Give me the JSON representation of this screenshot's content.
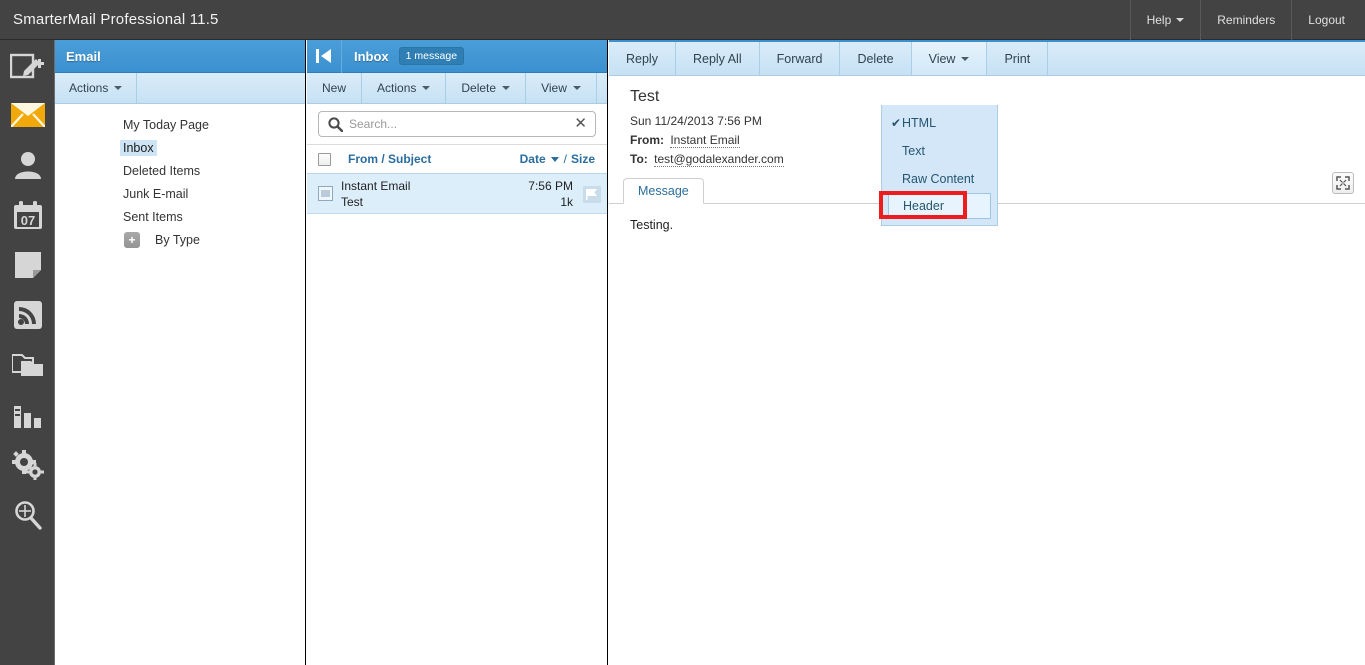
{
  "header": {
    "app_title": "SmarterMail Professional 11.5",
    "links": [
      {
        "label": "Help",
        "has_caret": true,
        "name": "help-menu"
      },
      {
        "label": "Reminders",
        "has_caret": false,
        "name": "reminders-link"
      },
      {
        "label": "Logout",
        "has_caret": false,
        "name": "logout-link"
      }
    ]
  },
  "rail": {
    "items": [
      {
        "icon": "compose-new-icon",
        "label": "New Message",
        "active": false
      },
      {
        "icon": "email-icon",
        "label": "Email",
        "active": true
      },
      {
        "icon": "contacts-icon",
        "label": "Contacts",
        "active": false
      },
      {
        "icon": "calendar-icon",
        "label": "Calendar",
        "active": false,
        "day": "07"
      },
      {
        "icon": "notes-icon",
        "label": "Notes",
        "active": false
      },
      {
        "icon": "rss-feeds-icon",
        "label": "RSS Feeds",
        "active": false
      },
      {
        "icon": "file-storage-icon",
        "label": "File Storage",
        "active": false
      },
      {
        "icon": "reports-icon",
        "label": "Reports",
        "active": false
      },
      {
        "icon": "settings-gear-icon",
        "label": "Settings",
        "active": false
      },
      {
        "icon": "search-icon",
        "label": "Search",
        "active": false
      }
    ]
  },
  "folders": {
    "title": "Email",
    "actions_label": "Actions",
    "tree": [
      {
        "label": "My Today Page",
        "selected": false,
        "expandable": false
      },
      {
        "label": "Inbox",
        "selected": true,
        "expandable": false
      },
      {
        "label": "Deleted Items",
        "selected": false,
        "expandable": false
      },
      {
        "label": "Junk E-mail",
        "selected": false,
        "expandable": false
      },
      {
        "label": "Sent Items",
        "selected": false,
        "expandable": false
      },
      {
        "label": "By Type",
        "selected": false,
        "expandable": true,
        "expander": "+"
      }
    ]
  },
  "msglist": {
    "folder_name": "Inbox",
    "count_badge": "1 message",
    "toolbar": [
      {
        "label": "New",
        "has_caret": false,
        "name": "new-button"
      },
      {
        "label": "Actions",
        "has_caret": true,
        "name": "list-actions-menu"
      },
      {
        "label": "Delete",
        "has_caret": true,
        "name": "list-delete-menu"
      },
      {
        "label": "View",
        "has_caret": true,
        "name": "list-view-menu"
      }
    ],
    "search": {
      "placeholder": "Search...",
      "value": ""
    },
    "columns": {
      "from_subject": "From / Subject",
      "date": "Date",
      "separator": "/",
      "size": "Size"
    },
    "rows": [
      {
        "from": "Instant Email",
        "subject": "Test",
        "time": "7:56 PM",
        "size": "1k",
        "selected": true
      }
    ]
  },
  "reading": {
    "toolbar": [
      {
        "label": "Reply",
        "has_caret": false,
        "active": false,
        "name": "reply-button"
      },
      {
        "label": "Reply All",
        "has_caret": false,
        "active": false,
        "name": "reply-all-button"
      },
      {
        "label": "Forward",
        "has_caret": false,
        "active": false,
        "name": "forward-button"
      },
      {
        "label": "Delete",
        "has_caret": false,
        "active": false,
        "name": "delete-button"
      },
      {
        "label": "View",
        "has_caret": true,
        "active": true,
        "name": "view-menu-button"
      },
      {
        "label": "Print",
        "has_caret": false,
        "active": false,
        "name": "print-button"
      }
    ],
    "subject": "Test",
    "date": "Sun 11/24/2013 7:56 PM",
    "from_label": "From:",
    "from_value": "Instant Email",
    "to_label": "To:",
    "to_value": "test@godalexander.com",
    "tab_label": "Message",
    "body": "Testing."
  },
  "view_menu": {
    "items": [
      {
        "label": "HTML",
        "checked": true,
        "highlighted": false
      },
      {
        "label": "Text",
        "checked": false,
        "highlighted": false
      },
      {
        "label": "Raw Content",
        "checked": false,
        "highlighted": false
      },
      {
        "label": "Header",
        "checked": false,
        "highlighted": true
      }
    ],
    "check_glyph": "✔"
  },
  "colors": {
    "chrome_dark": "#434343",
    "panel_header_blue": "#3b91cf",
    "toolbar_blue": "#c6e1f4",
    "menu_blue": "#d3e7f8",
    "selection_blue": "#ddeefb",
    "link_blue": "#2a6d9e",
    "highlight_red": "#ee1c1c",
    "email_icon_orange": "#f0a80a"
  }
}
